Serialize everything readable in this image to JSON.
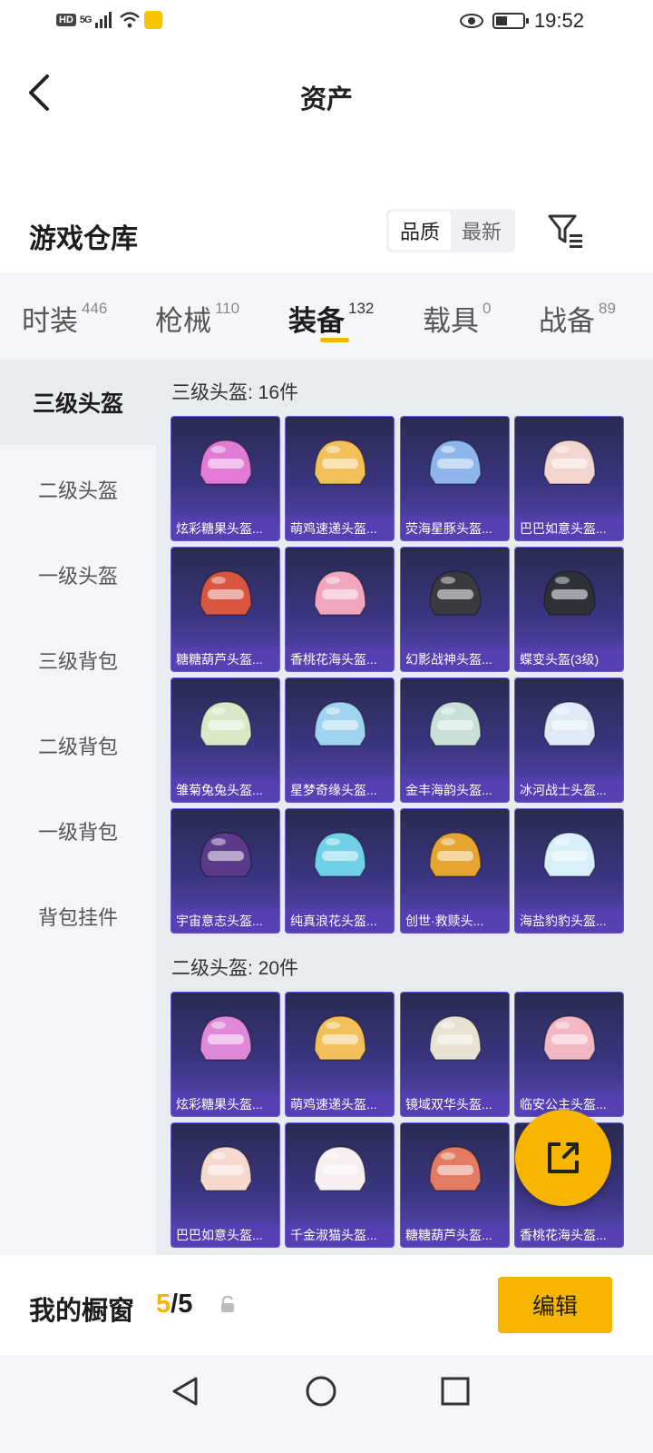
{
  "status_bar": {
    "hd": "HD",
    "signal": "5G",
    "time": "19:52"
  },
  "header": {
    "title": "资产"
  },
  "section": {
    "title": "游戏仓库",
    "sort_options": [
      "品质",
      "最新"
    ],
    "active_sort": "品质"
  },
  "tabs": [
    {
      "label": "时装",
      "count": "446"
    },
    {
      "label": "枪械",
      "count": "110"
    },
    {
      "label": "装备",
      "count": "132",
      "active": true
    },
    {
      "label": "载具",
      "count": "0"
    },
    {
      "label": "战备",
      "count": "89"
    }
  ],
  "sidebar": {
    "items": [
      "三级头盔",
      "二级头盔",
      "一级头盔",
      "三级背包",
      "二级背包",
      "一级背包",
      "背包挂件"
    ],
    "active": "三级头盔"
  },
  "groups": [
    {
      "title": "三级头盔: 16件",
      "items": [
        {
          "name": "炫彩糖果头盔...",
          "color": "#e27bd6"
        },
        {
          "name": "萌鸡速递头盔...",
          "color": "#f2c05a"
        },
        {
          "name": "荧海星豚头盔...",
          "color": "#8fb6ea"
        },
        {
          "name": "巴巴如意头盔...",
          "color": "#f3d5cf"
        },
        {
          "name": "糖糖葫芦头盔...",
          "color": "#d8553f"
        },
        {
          "name": "香桃花海头盔...",
          "color": "#f2a6bd"
        },
        {
          "name": "幻影战神头盔...",
          "color": "#3a3a40"
        },
        {
          "name": "蝶变头盔(3级)",
          "color": "#2f3138"
        },
        {
          "name": "雏菊兔兔头盔...",
          "color": "#dbe8c8"
        },
        {
          "name": "星梦奇缘头盔...",
          "color": "#9fd3ef"
        },
        {
          "name": "金丰海韵头盔...",
          "color": "#c8e0d6"
        },
        {
          "name": "冰河战士头盔...",
          "color": "#dfeaf6"
        },
        {
          "name": "宇宙意志头盔...",
          "color": "#5b3a8a"
        },
        {
          "name": "纯真浪花头盔...",
          "color": "#6fd0e8"
        },
        {
          "name": "创世·救赎头...",
          "color": "#e6a530"
        },
        {
          "name": "海盐豹豹头盔...",
          "color": "#d8eef8"
        }
      ]
    },
    {
      "title": "二级头盔: 20件",
      "items": [
        {
          "name": "炫彩糖果头盔...",
          "color": "#e089d8"
        },
        {
          "name": "萌鸡速递头盔...",
          "color": "#f2c05a"
        },
        {
          "name": "镜域双华头盔...",
          "color": "#e8e2d2"
        },
        {
          "name": "临安公主头盔...",
          "color": "#f2b8c4"
        },
        {
          "name": "巴巴如意头盔...",
          "color": "#f5d9cf"
        },
        {
          "name": "千金淑猫头盔...",
          "color": "#f7eef2"
        },
        {
          "name": "糖糖葫芦头盔...",
          "color": "#e37b62"
        },
        {
          "name": "香桃花海头盔...",
          "color": "#f2a6bd"
        }
      ]
    }
  ],
  "showcase": {
    "label": "我的橱窗",
    "current": "5",
    "total": "/5",
    "edit_label": "编辑"
  }
}
